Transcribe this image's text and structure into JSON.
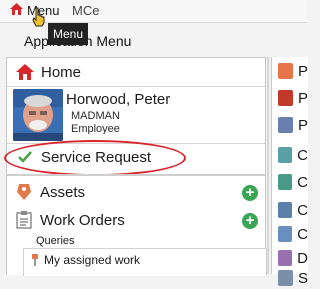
{
  "topbar": {
    "menu_label": "Menu",
    "app_short": "MCe",
    "tooltip": "Menu"
  },
  "app_title": "Application Menu",
  "nav": {
    "home": "Home",
    "profile": {
      "name": "Horwood, Peter",
      "username": "MADMAN",
      "role": "Employee"
    },
    "service_request": "Service Request",
    "assets": "Assets",
    "work_orders": "Work Orders",
    "queries_heading": "Queries",
    "query_item": "My assigned work"
  },
  "right_items": [
    "P",
    "P",
    "P",
    "C",
    "C",
    "C",
    "C",
    "D",
    "S"
  ],
  "colors": {
    "highlight_oval": "#d9262c",
    "add_button": "#3aa655"
  }
}
